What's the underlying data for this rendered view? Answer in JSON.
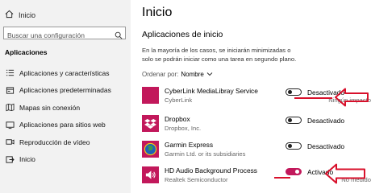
{
  "sidebar": {
    "home_label": "Inicio",
    "search_placeholder": "Buscar una configuración",
    "section_title": "Aplicaciones",
    "items": [
      {
        "label": "Aplicaciones y características",
        "icon": "list-icon"
      },
      {
        "label": "Aplicaciones predeterminadas",
        "icon": "default-apps-icon"
      },
      {
        "label": "Mapas sin conexión",
        "icon": "map-icon"
      },
      {
        "label": "Aplicaciones para sitios web",
        "icon": "web-apps-icon"
      },
      {
        "label": "Reproducción de vídeo",
        "icon": "video-icon"
      },
      {
        "label": "Inicio",
        "icon": "startup-icon"
      }
    ]
  },
  "main": {
    "title": "Inicio",
    "subtitle": "Aplicaciones de inicio",
    "description": "En la mayoría de los casos, se iniciarán minimizadas o solo se podrán iniciar como una tarea en segundo plano.",
    "sort_label": "Ordenar por:",
    "sort_value": "Nombre",
    "apps": [
      {
        "name": "CyberLink MediaLibray Service",
        "publisher": "CyberLink",
        "state": "Desactivado",
        "impact": "Ningún impacto",
        "on": false,
        "icon": "cyberlink-icon",
        "icon_color": "#c2185b"
      },
      {
        "name": "Dropbox",
        "publisher": "Dropbox, Inc.",
        "state": "Desactivado",
        "impact": "",
        "on": false,
        "icon": "dropbox-icon",
        "icon_color": "#c2185b"
      },
      {
        "name": "Garmin Express",
        "publisher": "Garmin Ltd. or its subsidiaries",
        "state": "Desactivado",
        "impact": "",
        "on": false,
        "icon": "garmin-globe-icon",
        "icon_color": "#c2185b"
      },
      {
        "name": "HD Audio Background Process",
        "publisher": "Realtek Semiconductor",
        "state": "Activado",
        "impact": "No medido",
        "on": true,
        "icon": "speaker-icon",
        "icon_color": "#c2185b"
      }
    ]
  },
  "colors": {
    "accent": "#c2185b",
    "annotation_red": "#d8102b"
  }
}
